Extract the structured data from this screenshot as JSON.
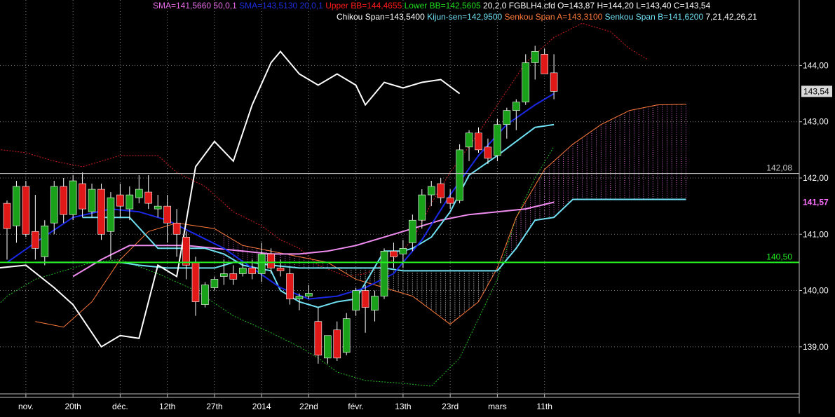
{
  "chart_data": {
    "type": "candlestick",
    "instrument": "FGBLH4.cfd",
    "ohlc_label": "O=143,87 H=144,20 L=143,40 C=143,54",
    "indicator_labels": [
      {
        "id": "sma50",
        "text": "SMA=141,5660  50,0,1",
        "color": "#e86ee8"
      },
      {
        "id": "sma20",
        "text": "SMA=143,5130  20,0,1",
        "color": "#1c2ee0"
      },
      {
        "id": "bb_upper",
        "text": "Upper BB=144,4655",
        "color": "#ff1a1a"
      },
      {
        "id": "bb_lower",
        "text": "Lower BB=142,5605",
        "color": "#1fe01f"
      },
      {
        "id": "bb_params",
        "text": "20,2,0",
        "color": "#ffffff"
      },
      {
        "id": "chikou",
        "text": "Chikou Span=143,5400",
        "color": "#ffffff"
      },
      {
        "id": "kijun",
        "text": "Kijun-sen=142,9500",
        "color": "#6fe0f2"
      },
      {
        "id": "senkou_a",
        "text": "Senkou Span A=143,3100",
        "color": "#ff7a3c"
      },
      {
        "id": "senkou_b",
        "text": "Senkou Span B=141,6200",
        "color": "#6fe0f2"
      },
      {
        "id": "ichi_params",
        "text": "7,21,42,26,21",
        "color": "#ffffff"
      }
    ],
    "y_range": [
      138.35,
      144.84
    ],
    "y_ticks": [
      {
        "value": 139,
        "label": "139,00"
      },
      {
        "value": 140,
        "label": "140,00"
      },
      {
        "value": 141,
        "label": "141,00"
      },
      {
        "value": 142,
        "label": "142,00"
      },
      {
        "value": 143,
        "label": "143,00"
      },
      {
        "value": 144,
        "label": "144,00"
      }
    ],
    "x_ticks": [
      {
        "bar": 2,
        "label": "nov."
      },
      {
        "bar": 7,
        "label": "20th"
      },
      {
        "bar": 12,
        "label": "déc."
      },
      {
        "bar": 17,
        "label": "12th"
      },
      {
        "bar": 22,
        "label": "27th"
      },
      {
        "bar": 27,
        "label": "2014"
      },
      {
        "bar": 32,
        "label": "22nd"
      },
      {
        "bar": 37,
        "label": "févr."
      },
      {
        "bar": 42,
        "label": "13th"
      },
      {
        "bar": 47,
        "label": "23rd"
      },
      {
        "bar": 52,
        "label": "mars"
      },
      {
        "bar": 57,
        "label": "11th"
      }
    ],
    "grid": true,
    "price_tags": [
      {
        "value": 143.54,
        "label": "143,54",
        "style": "box"
      },
      {
        "value": 142.08,
        "label": "142,08",
        "style": "line",
        "color": "#c8c8c8"
      },
      {
        "value": 141.57,
        "label": "141,57",
        "style": "text",
        "color": "#ff70ff"
      },
      {
        "value": 140.5,
        "label": "140,50",
        "style": "line",
        "color": "#22ee22"
      }
    ],
    "ohlc": [
      [
        141.55,
        141.6,
        140.55,
        141.1
      ],
      [
        141.15,
        141.95,
        140.85,
        141.85
      ],
      [
        141.85,
        141.95,
        140.95,
        141.0
      ],
      [
        141.05,
        141.7,
        140.55,
        140.75
      ],
      [
        140.6,
        141.25,
        140.45,
        141.15
      ],
      [
        141.2,
        141.95,
        141.0,
        141.85
      ],
      [
        141.85,
        142.0,
        141.2,
        141.35
      ],
      [
        141.35,
        142.05,
        141.25,
        141.95
      ],
      [
        141.9,
        142.1,
        141.3,
        141.45
      ],
      [
        141.4,
        141.9,
        141.3,
        141.8
      ],
      [
        141.8,
        141.9,
        140.9,
        141.0
      ],
      [
        141.05,
        141.75,
        140.55,
        141.65
      ],
      [
        141.7,
        141.9,
        141.3,
        141.5
      ],
      [
        141.45,
        141.85,
        141.25,
        141.7
      ],
      [
        141.65,
        142.05,
        141.55,
        141.8
      ],
      [
        141.75,
        142.05,
        141.45,
        141.55
      ],
      [
        141.45,
        141.7,
        141.3,
        141.5
      ],
      [
        141.5,
        141.7,
        140.85,
        141.2
      ],
      [
        141.2,
        141.45,
        140.6,
        141.0
      ],
      [
        140.95,
        141.05,
        140.2,
        140.45
      ],
      [
        140.5,
        140.6,
        139.55,
        139.8
      ],
      [
        139.75,
        140.15,
        139.7,
        140.1
      ],
      [
        140.05,
        140.25,
        140.0,
        140.2
      ],
      [
        140.25,
        140.55,
        140.1,
        140.3
      ],
      [
        140.3,
        140.45,
        140.1,
        140.2
      ],
      [
        140.3,
        140.5,
        140.25,
        140.4
      ],
      [
        140.4,
        140.55,
        140.2,
        140.3
      ],
      [
        140.3,
        140.85,
        140.15,
        140.65
      ],
      [
        140.65,
        140.75,
        140.3,
        140.4
      ],
      [
        140.4,
        140.55,
        140.25,
        140.35
      ],
      [
        140.3,
        140.4,
        139.75,
        139.85
      ],
      [
        139.85,
        139.95,
        139.65,
        139.9
      ],
      [
        139.9,
        140.1,
        139.85,
        139.95
      ],
      [
        139.45,
        139.7,
        138.7,
        138.85
      ],
      [
        138.8,
        139.2,
        138.7,
        139.2
      ],
      [
        139.3,
        139.45,
        138.75,
        138.8
      ],
      [
        138.9,
        139.6,
        138.85,
        139.5
      ],
      [
        139.65,
        140.05,
        139.55,
        140.0
      ],
      [
        140.0,
        140.1,
        139.25,
        139.7
      ],
      [
        139.65,
        140.0,
        139.45,
        139.9
      ],
      [
        139.9,
        140.75,
        139.85,
        140.7
      ],
      [
        140.7,
        140.85,
        140.4,
        140.6
      ],
      [
        140.65,
        140.9,
        140.4,
        140.75
      ],
      [
        140.85,
        141.35,
        140.7,
        141.25
      ],
      [
        141.25,
        141.8,
        141.1,
        141.7
      ],
      [
        141.7,
        141.95,
        141.5,
        141.85
      ],
      [
        141.9,
        142.0,
        141.55,
        141.65
      ],
      [
        141.65,
        141.8,
        141.45,
        141.55
      ],
      [
        141.6,
        142.6,
        141.55,
        142.5
      ],
      [
        142.55,
        142.85,
        142.3,
        142.8
      ],
      [
        142.8,
        142.9,
        142.45,
        142.5
      ],
      [
        142.55,
        142.7,
        142.25,
        142.35
      ],
      [
        142.4,
        143.05,
        142.3,
        142.95
      ],
      [
        142.95,
        143.25,
        142.7,
        143.2
      ],
      [
        143.2,
        143.4,
        142.85,
        143.35
      ],
      [
        143.35,
        144.2,
        143.3,
        144.05
      ],
      [
        144.05,
        144.35,
        143.75,
        144.25
      ],
      [
        144.2,
        144.3,
        143.9,
        143.85
      ],
      [
        143.87,
        144.2,
        143.4,
        143.54
      ]
    ],
    "sma20": [
      [
        0,
        140.5
      ],
      [
        3,
        140.85
      ],
      [
        7,
        141.3
      ],
      [
        11,
        141.45
      ],
      [
        14,
        141.4
      ],
      [
        17,
        141.25
      ],
      [
        20,
        141.0
      ],
      [
        23,
        140.75
      ],
      [
        26,
        140.4
      ],
      [
        29,
        140.05
      ],
      [
        32,
        139.85
      ],
      [
        35,
        139.9
      ],
      [
        38,
        140.05
      ],
      [
        41,
        140.3
      ],
      [
        44,
        140.9
      ],
      [
        47,
        141.7
      ],
      [
        50,
        142.4
      ],
      [
        53,
        142.95
      ],
      [
        56,
        143.3
      ],
      [
        58,
        143.5
      ]
    ],
    "sma50": [
      [
        7,
        140.25
      ],
      [
        10,
        140.55
      ],
      [
        13,
        140.8
      ],
      [
        16,
        140.8
      ],
      [
        19,
        140.8
      ],
      [
        22,
        140.75
      ],
      [
        25,
        140.7
      ],
      [
        28,
        140.65
      ],
      [
        31,
        140.65
      ],
      [
        34,
        140.7
      ],
      [
        37,
        140.8
      ],
      [
        40,
        140.95
      ],
      [
        43,
        141.1
      ],
      [
        46,
        141.25
      ],
      [
        49,
        141.35
      ],
      [
        52,
        141.4
      ],
      [
        55,
        141.45
      ],
      [
        58,
        141.57
      ]
    ],
    "kijun": [
      [
        8,
        141.3
      ],
      [
        13,
        141.3
      ],
      [
        16,
        140.75
      ],
      [
        21,
        140.75
      ],
      [
        23,
        140.65
      ],
      [
        25,
        140.45
      ],
      [
        28,
        140.35
      ],
      [
        29,
        140.0
      ],
      [
        31,
        139.8
      ],
      [
        33,
        139.7
      ],
      [
        35,
        139.8
      ],
      [
        37,
        139.85
      ],
      [
        40,
        140.7
      ],
      [
        42,
        140.7
      ],
      [
        43,
        140.75
      ],
      [
        45,
        140.95
      ],
      [
        47,
        141.4
      ],
      [
        49,
        142.05
      ],
      [
        52,
        142.4
      ],
      [
        54,
        142.65
      ],
      [
        56,
        142.9
      ],
      [
        58,
        142.95
      ]
    ],
    "chikou": [
      [
        -4,
        140.25
      ],
      [
        -1,
        140.4
      ],
      [
        2,
        140.45
      ],
      [
        5,
        140.05
      ],
      [
        7,
        139.75
      ],
      [
        10,
        139.0
      ],
      [
        12,
        139.2
      ],
      [
        14,
        139.15
      ],
      [
        16,
        140.45
      ],
      [
        18,
        140.25
      ],
      [
        20,
        142.2
      ],
      [
        22,
        142.65
      ],
      [
        24,
        142.3
      ],
      [
        26,
        143.3
      ],
      [
        28,
        144.05
      ],
      [
        29,
        144.25
      ],
      [
        31,
        143.85
      ],
      [
        33,
        143.65
      ],
      [
        35,
        143.85
      ],
      [
        37,
        143.65
      ],
      [
        38,
        143.3
      ],
      [
        40,
        143.7
      ],
      [
        42,
        143.6
      ],
      [
        44,
        143.7
      ],
      [
        46,
        143.75
      ],
      [
        48,
        143.5
      ]
    ],
    "bb_upper": [
      [
        -3,
        142.55
      ],
      [
        2,
        142.45
      ],
      [
        5,
        142.3
      ],
      [
        8,
        142.2
      ],
      [
        12,
        142.4
      ],
      [
        16,
        142.4
      ],
      [
        18,
        142.1
      ],
      [
        21,
        141.85
      ],
      [
        24,
        141.4
      ],
      [
        27,
        141.15
      ],
      [
        29,
        140.9
      ],
      [
        31,
        140.75
      ],
      [
        33,
        140.45
      ],
      [
        36,
        140.25
      ],
      [
        38,
        140.3
      ],
      [
        41,
        140.55
      ],
      [
        43,
        140.9
      ],
      [
        45,
        141.55
      ],
      [
        47,
        142.1
      ],
      [
        50,
        142.8
      ],
      [
        53,
        143.55
      ],
      [
        55,
        144.05
      ],
      [
        58,
        144.5
      ],
      [
        61,
        144.75
      ],
      [
        64,
        144.6
      ],
      [
        66,
        144.3
      ],
      [
        68,
        144.1
      ]
    ],
    "bb_lower": [
      [
        -3,
        139.4
      ],
      [
        0,
        139.9
      ],
      [
        3,
        140.2
      ],
      [
        6,
        140.35
      ],
      [
        9,
        140.5
      ],
      [
        12,
        140.55
      ],
      [
        16,
        140.3
      ],
      [
        20,
        140.0
      ],
      [
        24,
        139.55
      ],
      [
        28,
        139.25
      ],
      [
        31,
        139.0
      ],
      [
        33,
        138.8
      ],
      [
        35,
        138.55
      ],
      [
        38,
        138.4
      ],
      [
        42,
        138.35
      ],
      [
        45,
        138.3
      ],
      [
        48,
        138.8
      ],
      [
        50,
        139.5
      ],
      [
        52,
        140.2
      ],
      [
        54,
        141.3
      ],
      [
        56,
        142.0
      ],
      [
        58,
        142.56
      ]
    ],
    "senkou_a": [
      [
        3,
        139.45
      ],
      [
        6,
        139.35
      ],
      [
        9,
        139.8
      ],
      [
        12,
        140.55
      ],
      [
        15,
        141.05
      ],
      [
        18,
        141.2
      ],
      [
        22,
        141.1
      ],
      [
        25,
        140.8
      ],
      [
        28,
        140.7
      ],
      [
        31,
        140.6
      ],
      [
        34,
        140.5
      ],
      [
        37,
        140.2
      ],
      [
        40,
        140.05
      ],
      [
        43,
        139.9
      ],
      [
        45,
        139.65
      ],
      [
        47,
        139.4
      ],
      [
        50,
        139.8
      ],
      [
        52,
        140.4
      ],
      [
        54,
        141.3
      ],
      [
        57,
        142.15
      ],
      [
        60,
        142.6
      ],
      [
        63,
        142.95
      ],
      [
        66,
        143.2
      ],
      [
        69,
        143.3
      ],
      [
        72,
        143.31
      ]
    ],
    "senkou_b": [
      [
        3,
        140.5
      ],
      [
        12,
        140.5
      ],
      [
        14,
        140.45
      ],
      [
        17,
        140.4
      ],
      [
        22,
        140.4
      ],
      [
        24,
        140.5
      ],
      [
        26,
        140.5
      ],
      [
        28,
        140.45
      ],
      [
        31,
        140.4
      ],
      [
        33,
        140.4
      ],
      [
        37,
        140.4
      ],
      [
        40,
        140.4
      ],
      [
        42,
        140.35
      ],
      [
        52,
        140.35
      ],
      [
        54,
        140.75
      ],
      [
        56,
        141.25
      ],
      [
        58,
        141.3
      ],
      [
        60,
        141.62
      ],
      [
        72,
        141.62
      ]
    ],
    "cloud_window": [
      23,
      72
    ]
  }
}
